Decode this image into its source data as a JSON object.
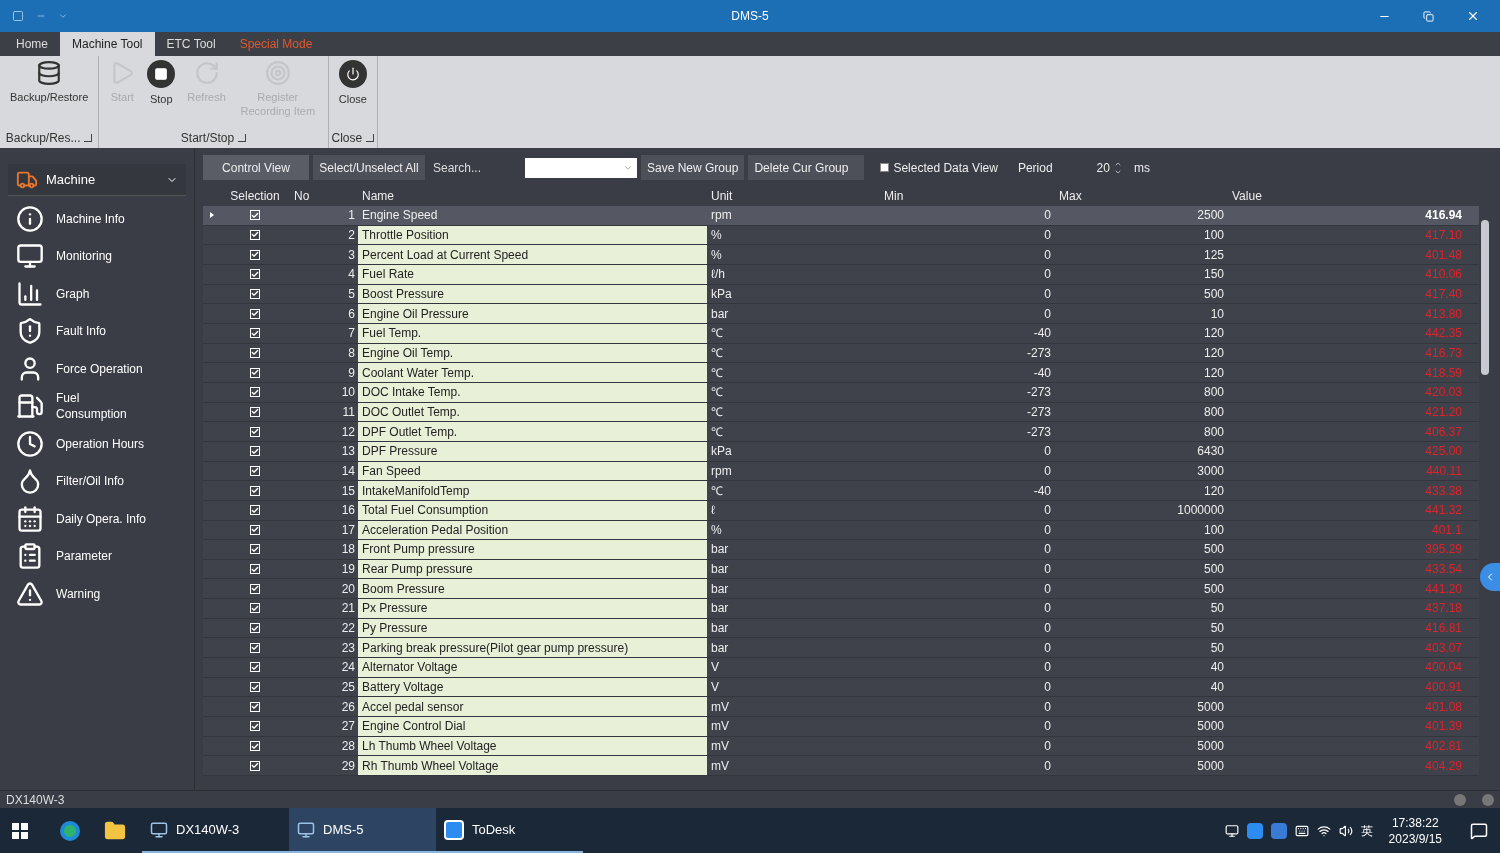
{
  "window": {
    "title": "DMS-5"
  },
  "ribbon_tabs": [
    {
      "label": "Home",
      "selected": false,
      "kind": "normal"
    },
    {
      "label": "Machine Tool",
      "selected": true,
      "kind": "normal"
    },
    {
      "label": "ETC Tool",
      "selected": false,
      "kind": "normal"
    },
    {
      "label": "Special Mode",
      "selected": false,
      "kind": "special"
    }
  ],
  "ribbon_groups": [
    {
      "label": "Backup/Res...",
      "buttons": [
        {
          "label": "Backup/Restore",
          "disabled": false
        }
      ]
    },
    {
      "label": "Start/Stop",
      "buttons": [
        {
          "label": "Start",
          "disabled": true
        },
        {
          "label": "Stop",
          "disabled": false
        },
        {
          "label": "Refresh",
          "disabled": true
        },
        {
          "label": "Register Recording Item",
          "disabled": true
        }
      ]
    },
    {
      "label": "Close",
      "buttons": [
        {
          "label": "Close",
          "disabled": false
        }
      ]
    }
  ],
  "sidebar": {
    "header": "Machine",
    "items": [
      {
        "label": "Machine Info"
      },
      {
        "label": "Monitoring"
      },
      {
        "label": "Graph"
      },
      {
        "label": "Fault Info"
      },
      {
        "label": "Force Operation"
      },
      {
        "label": "Fuel Consumption"
      },
      {
        "label": "Operation Hours"
      },
      {
        "label": "Filter/Oil Info"
      },
      {
        "label": "Daily Opera. Info"
      },
      {
        "label": "Parameter"
      },
      {
        "label": "Warning"
      }
    ]
  },
  "toolbar": {
    "control_view": "Control View",
    "select_all": "Select/Unselect All",
    "search_placeholder": "Search...",
    "save_group": "Save New Group",
    "delete_group": "Delete Cur Group",
    "selected_data_view": {
      "label": "Selected Data View",
      "checked": false
    },
    "period_label": "Period",
    "period_value": "20",
    "period_unit": "ms"
  },
  "table": {
    "columns": [
      "Selection",
      "No",
      "Name",
      "Unit",
      "Min",
      "Max",
      "Value"
    ],
    "rows": [
      {
        "no": "1",
        "name": "Engine Speed",
        "unit": "rpm",
        "min": "0",
        "max": "2500",
        "value": "416.94",
        "checked": true,
        "selected": true,
        "alarm": false
      },
      {
        "no": "2",
        "name": "Throttle Position",
        "unit": "%",
        "min": "0",
        "max": "100",
        "value": "417.10",
        "checked": true,
        "selected": false,
        "alarm": true
      },
      {
        "no": "3",
        "name": "Percent Load at Current Speed",
        "unit": "%",
        "min": "0",
        "max": "125",
        "value": "401.48",
        "checked": true,
        "selected": false,
        "alarm": true
      },
      {
        "no": "4",
        "name": "Fuel Rate",
        "unit": "ℓ/h",
        "min": "0",
        "max": "150",
        "value": "410.06",
        "checked": true,
        "selected": false,
        "alarm": true
      },
      {
        "no": "5",
        "name": "Boost Pressure",
        "unit": "kPa",
        "min": "0",
        "max": "500",
        "value": "417.40",
        "checked": true,
        "selected": false,
        "alarm": true
      },
      {
        "no": "6",
        "name": "Engine Oil Pressure",
        "unit": "bar",
        "min": "0",
        "max": "10",
        "value": "413.80",
        "checked": true,
        "selected": false,
        "alarm": true
      },
      {
        "no": "7",
        "name": "Fuel Temp.",
        "unit": "℃",
        "min": "-40",
        "max": "120",
        "value": "442.35",
        "checked": true,
        "selected": false,
        "alarm": true
      },
      {
        "no": "8",
        "name": "Engine Oil Temp.",
        "unit": "℃",
        "min": "-273",
        "max": "120",
        "value": "416.73",
        "checked": true,
        "selected": false,
        "alarm": true
      },
      {
        "no": "9",
        "name": "Coolant Water Temp.",
        "unit": "℃",
        "min": "-40",
        "max": "120",
        "value": "418.59",
        "checked": true,
        "selected": false,
        "alarm": true
      },
      {
        "no": "10",
        "name": "DOC Intake Temp.",
        "unit": "℃",
        "min": "-273",
        "max": "800",
        "value": "420.03",
        "checked": true,
        "selected": false,
        "alarm": true
      },
      {
        "no": "11",
        "name": "DOC Outlet Temp.",
        "unit": "℃",
        "min": "-273",
        "max": "800",
        "value": "421.20",
        "checked": true,
        "selected": false,
        "alarm": true
      },
      {
        "no": "12",
        "name": "DPF Outlet Temp.",
        "unit": "℃",
        "min": "-273",
        "max": "800",
        "value": "406.37",
        "checked": true,
        "selected": false,
        "alarm": true
      },
      {
        "no": "13",
        "name": "DPF Pressure",
        "unit": "kPa",
        "min": "0",
        "max": "6430",
        "value": "425.00",
        "checked": true,
        "selected": false,
        "alarm": true
      },
      {
        "no": "14",
        "name": "Fan Speed",
        "unit": "rpm",
        "min": "0",
        "max": "3000",
        "value": "440.11",
        "checked": true,
        "selected": false,
        "alarm": true
      },
      {
        "no": "15",
        "name": "IntakeManifoldTemp",
        "unit": "℃",
        "min": "-40",
        "max": "120",
        "value": "433.38",
        "checked": true,
        "selected": false,
        "alarm": true
      },
      {
        "no": "16",
        "name": "Total Fuel Consumption",
        "unit": "ℓ",
        "min": "0",
        "max": "1000000",
        "value": "441.32",
        "checked": true,
        "selected": false,
        "alarm": true
      },
      {
        "no": "17",
        "name": "Acceleration Pedal Position",
        "unit": "%",
        "min": "0",
        "max": "100",
        "value": "401.1",
        "checked": true,
        "selected": false,
        "alarm": true
      },
      {
        "no": "18",
        "name": "Front Pump pressure",
        "unit": "bar",
        "min": "0",
        "max": "500",
        "value": "395.29",
        "checked": true,
        "selected": false,
        "alarm": true
      },
      {
        "no": "19",
        "name": "Rear Pump pressure",
        "unit": "bar",
        "min": "0",
        "max": "500",
        "value": "433.54",
        "checked": true,
        "selected": false,
        "alarm": true
      },
      {
        "no": "20",
        "name": "Boom Pressure",
        "unit": "bar",
        "min": "0",
        "max": "500",
        "value": "441.20",
        "checked": true,
        "selected": false,
        "alarm": true
      },
      {
        "no": "21",
        "name": "Px Pressure",
        "unit": "bar",
        "min": "0",
        "max": "50",
        "value": "437.18",
        "checked": true,
        "selected": false,
        "alarm": true
      },
      {
        "no": "22",
        "name": "Py Pressure",
        "unit": "bar",
        "min": "0",
        "max": "50",
        "value": "416.81",
        "checked": true,
        "selected": false,
        "alarm": true
      },
      {
        "no": "23",
        "name": "Parking break pressure(Pilot gear pump pressure)",
        "unit": "bar",
        "min": "0",
        "max": "50",
        "value": "403.07",
        "checked": true,
        "selected": false,
        "alarm": true
      },
      {
        "no": "24",
        "name": "Alternator Voltage",
        "unit": "V",
        "min": "0",
        "max": "40",
        "value": "400.04",
        "checked": true,
        "selected": false,
        "alarm": true
      },
      {
        "no": "25",
        "name": "Battery Voltage",
        "unit": "V",
        "min": "0",
        "max": "40",
        "value": "400.91",
        "checked": true,
        "selected": false,
        "alarm": true
      },
      {
        "no": "26",
        "name": "Accel pedal sensor",
        "unit": "mV",
        "min": "0",
        "max": "5000",
        "value": "401.08",
        "checked": true,
        "selected": false,
        "alarm": true
      },
      {
        "no": "27",
        "name": "Engine Control Dial",
        "unit": "mV",
        "min": "0",
        "max": "5000",
        "value": "401.39",
        "checked": true,
        "selected": false,
        "alarm": true
      },
      {
        "no": "28",
        "name": "Lh Thumb Wheel Voltage",
        "unit": "mV",
        "min": "0",
        "max": "5000",
        "value": "402.81",
        "checked": true,
        "selected": false,
        "alarm": true
      },
      {
        "no": "29",
        "name": "Rh Thumb Wheel Voltage",
        "unit": "mV",
        "min": "0",
        "max": "5000",
        "value": "404.29",
        "checked": true,
        "selected": false,
        "alarm": true
      }
    ]
  },
  "status_bar": {
    "model": "DX140W-3"
  },
  "taskbar": {
    "apps": [
      {
        "label": "DX140W-3",
        "selected": false
      },
      {
        "label": "DMS-5",
        "selected": true
      },
      {
        "label": "ToDesk",
        "selected": false
      }
    ],
    "ime": "英",
    "time": "17:38:22",
    "date": "2023/9/15"
  }
}
